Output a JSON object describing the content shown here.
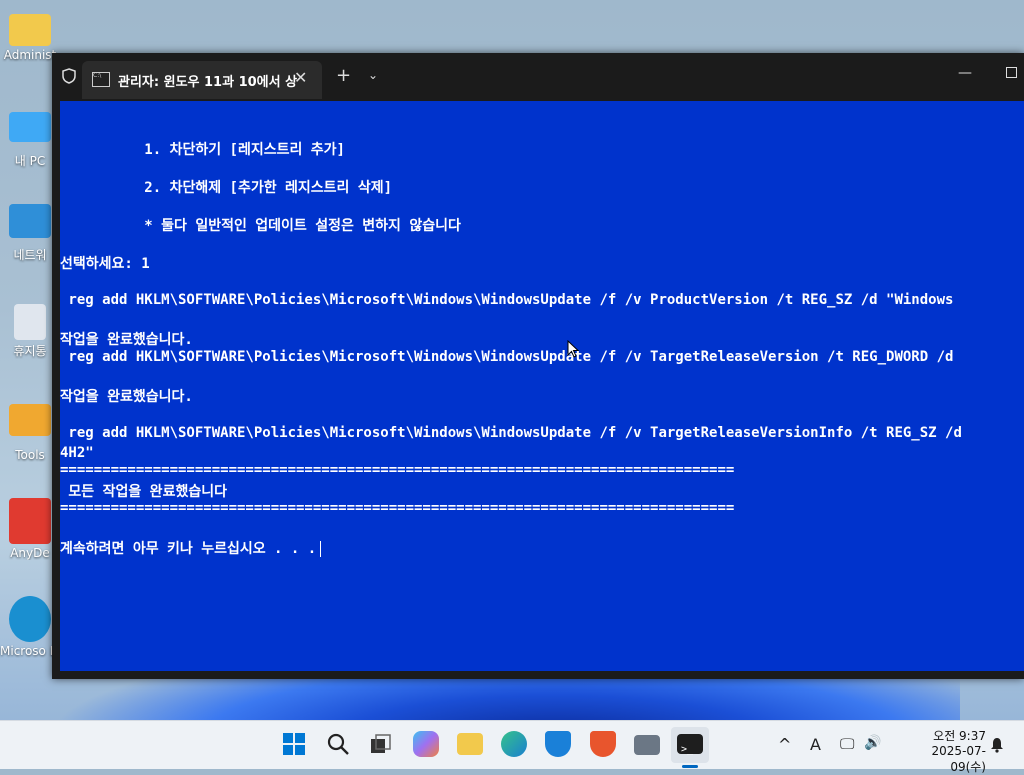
{
  "desktop": {
    "icons": [
      {
        "label": "Administ",
        "color": "#f2c94c"
      },
      {
        "label": "내 PC",
        "color": "#3fa9f5"
      },
      {
        "label": "네트워",
        "color": "#2f8fd8"
      },
      {
        "label": "휴지통",
        "color": "#e0e6ee"
      },
      {
        "label": "Tools",
        "color": "#f0a830"
      },
      {
        "label": "AnyDe",
        "color": "#e03a30"
      },
      {
        "label": "Microso Edge",
        "color": "#1a8fd0"
      }
    ]
  },
  "window": {
    "tab_title": "관리자:  윈도우 11과 10에서 상",
    "new_tab": "+",
    "dropdown": "⌄",
    "minimize": "—"
  },
  "console": {
    "lines": [
      "          1. 차단하기 [레지스트리 추가]",
      "          2. 차단해제 [추가한 레지스트리 삭제]",
      "          * 둘다 일반적인 업데이트 설정은 변하지 않습니다",
      "선택하세요: 1",
      " reg add HKLM\\SOFTWARE\\Policies\\Microsoft\\Windows\\WindowsUpdate /f /v ProductVersion /t REG_SZ /d \"Windows",
      "작업을 완료했습니다.",
      " reg add HKLM\\SOFTWARE\\Policies\\Microsoft\\Windows\\WindowsUpdate /f /v TargetReleaseVersion /t REG_DWORD /d",
      "작업을 완료했습니다.",
      " reg add HKLM\\SOFTWARE\\Policies\\Microsoft\\Windows\\WindowsUpdate /f /v TargetReleaseVersionInfo /t REG_SZ /d",
      "4H2\"",
      "================================================================================",
      " 모든 작업을 완료했습니다",
      "================================================================================",
      "계속하려면 아무 키나 누르십시오 . . ."
    ]
  },
  "taskbar": {
    "apps": [
      "windows-start",
      "search",
      "task-view",
      "copilot",
      "file-explorer",
      "edge",
      "defender",
      "brave",
      "printer",
      "terminal"
    ],
    "tray": {
      "chevron": "^",
      "ime": "A",
      "network": "🖵",
      "volume": "🔊"
    },
    "time": "오전 9:37",
    "date": "2025-07-09(수)"
  }
}
